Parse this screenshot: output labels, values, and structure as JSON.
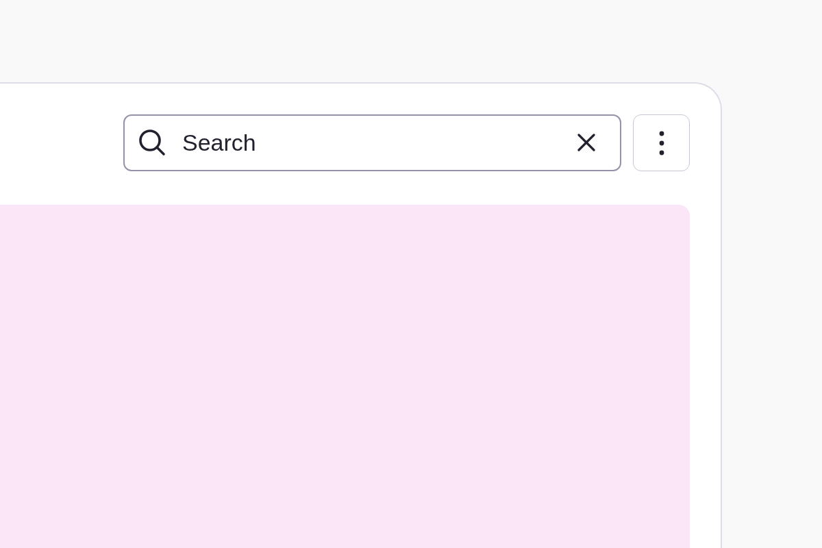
{
  "search": {
    "value": "Search"
  }
}
